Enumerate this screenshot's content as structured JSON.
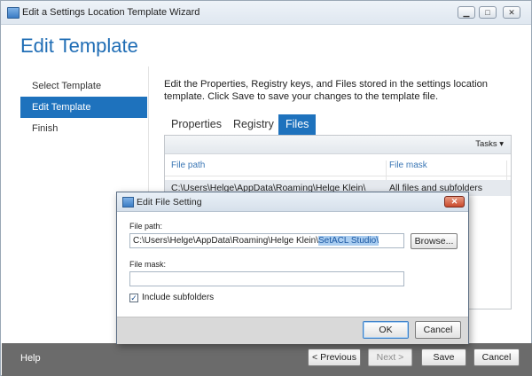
{
  "window": {
    "title": "Edit a Settings Location Template Wizard"
  },
  "page": {
    "heading": "Edit Template",
    "description": "Edit the Properties, Registry keys, and Files stored in the settings location template. Click Save to save your changes to the template file."
  },
  "sidebar": {
    "items": [
      {
        "label": "Select Template",
        "active": false
      },
      {
        "label": "Edit Template",
        "active": true
      },
      {
        "label": "Finish",
        "active": false
      }
    ]
  },
  "tabs": [
    {
      "label": "Properties",
      "active": false
    },
    {
      "label": "Registry",
      "active": false
    },
    {
      "label": "Files",
      "active": true
    }
  ],
  "files_panel": {
    "tasks_label": "Tasks",
    "columns": [
      "File path",
      "File mask"
    ],
    "rows": [
      {
        "path": "C:\\Users\\Helge\\AppData\\Roaming\\Helge Klein\\",
        "mask": "All files and subfolders"
      }
    ]
  },
  "footer": {
    "help": "Help",
    "previous": "< Previous",
    "next": "Next >",
    "save": "Save",
    "cancel": "Cancel"
  },
  "dialog": {
    "title": "Edit File Setting",
    "file_path_label": "File path:",
    "file_path_value": "C:\\Users\\Helge\\AppData\\Roaming\\Helge Klein\\",
    "file_path_selected": "SetACL Studio\\",
    "browse": "Browse...",
    "file_mask_label": "File mask:",
    "file_mask_value": "",
    "include_subfolders_label": "Include subfolders",
    "include_subfolders_checked": true,
    "ok": "OK",
    "cancel": "Cancel"
  },
  "colors": {
    "accent": "#1e72bd",
    "footer": "#6b6b6b"
  }
}
